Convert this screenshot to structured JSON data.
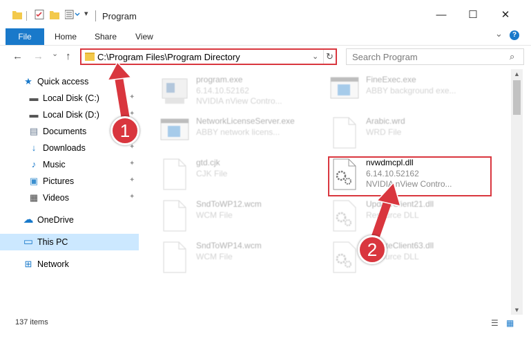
{
  "window": {
    "title": "Program",
    "minimize_glyph": "—",
    "maximize_glyph": "☐",
    "close_glyph": "✕"
  },
  "ribbon": {
    "tabs": [
      "File",
      "Home",
      "Share",
      "View"
    ],
    "expand_glyph": "⌄",
    "help_glyph": "?"
  },
  "navigation": {
    "back_glyph": "←",
    "forward_glyph": "→",
    "recent_glyph": "⌄",
    "up_glyph": "↑",
    "address": "C:\\Program Files\\Program Directory",
    "address_dropdown_glyph": "⌄",
    "refresh_glyph": "↻",
    "search_placeholder": "Search Program",
    "search_glyph": "⌕"
  },
  "sidebar": {
    "items": [
      {
        "label": "Quick access",
        "icon": "star-icon",
        "glyph": "★",
        "color": "#1979ca",
        "pinned": false
      },
      {
        "label": "Local Disk (C:)",
        "icon": "drive-icon",
        "glyph": "▬",
        "color": "#555555",
        "pinned": true
      },
      {
        "label": "Local Disk (D:)",
        "icon": "drive-icon",
        "glyph": "▬",
        "color": "#555555",
        "pinned": true
      },
      {
        "label": "Documents",
        "icon": "documents-icon",
        "glyph": "▤",
        "color": "#6b7c93",
        "pinned": true
      },
      {
        "label": "Downloads",
        "icon": "download-icon",
        "glyph": "↓",
        "color": "#1979ca",
        "pinned": true
      },
      {
        "label": "Music",
        "icon": "music-icon",
        "glyph": "♪",
        "color": "#1979ca",
        "pinned": true
      },
      {
        "label": "Pictures",
        "icon": "pictures-icon",
        "glyph": "▣",
        "color": "#3a8fd0",
        "pinned": true
      },
      {
        "label": "Videos",
        "icon": "videos-icon",
        "glyph": "▦",
        "color": "#444444",
        "pinned": true
      },
      {
        "label": "OneDrive",
        "icon": "cloud-icon",
        "glyph": "☁",
        "color": "#1979ca",
        "pinned": false
      },
      {
        "label": "This PC",
        "icon": "computer-icon",
        "glyph": "▭",
        "color": "#1979ca",
        "pinned": false,
        "selected": true
      },
      {
        "label": "Network",
        "icon": "network-icon",
        "glyph": "⊞",
        "color": "#1979ca",
        "pinned": false
      }
    ],
    "pin_glyph": "📌"
  },
  "files": [
    {
      "name": "program.exe",
      "line2": "6.14.10.52162",
      "line3": "NVIDIA nView Contro...",
      "kind": "exe"
    },
    {
      "name": "FineExec.exe",
      "line2": "ABBY background exe...",
      "line3": "",
      "kind": "exe"
    },
    {
      "name": "NetworkLicenseServer.exe",
      "line2": "ABBY network licens...",
      "line3": "",
      "kind": "exe"
    },
    {
      "name": "Arabic.wrd",
      "line2": "WRD File",
      "line3": "",
      "kind": "doc"
    },
    {
      "name": "gtd.cjk",
      "line2": "CJK File",
      "line3": "",
      "kind": "doc"
    },
    {
      "name": "nvwdmcpl.dll",
      "line2": "6.14.10.52162",
      "line3": "NVIDIA nView Contro...",
      "kind": "dll",
      "highlight": true
    },
    {
      "name": "SndToWP12.wcm",
      "line2": "WCM File",
      "line3": "",
      "kind": "doc"
    },
    {
      "name": "UpdateClient21.dll",
      "line2": "Resource DLL",
      "line3": "",
      "kind": "dll"
    },
    {
      "name": "SndToWP14.wcm",
      "line2": "WCM File",
      "line3": "",
      "kind": "doc"
    },
    {
      "name": "UpdateClient63.dll",
      "line2": "Resource DLL",
      "line3": "",
      "kind": "dll"
    }
  ],
  "status": {
    "item_count": "137 items",
    "details_view_glyph": "☰",
    "large_icons_glyph": "▦"
  },
  "annotations": {
    "step1": "1",
    "step2": "2",
    "accent_color": "#d9363e"
  }
}
